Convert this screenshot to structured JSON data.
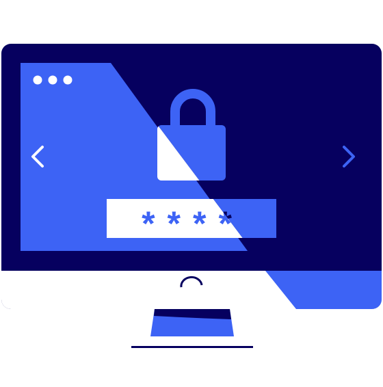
{
  "illustration": {
    "password_mask": "****",
    "colors": {
      "navy": "#06005f",
      "blue": "#3d63f5",
      "white": "#ffffff"
    },
    "icons": [
      "lock-icon",
      "chevron-left-icon",
      "chevron-right-icon",
      "window-dots-icon"
    ]
  }
}
